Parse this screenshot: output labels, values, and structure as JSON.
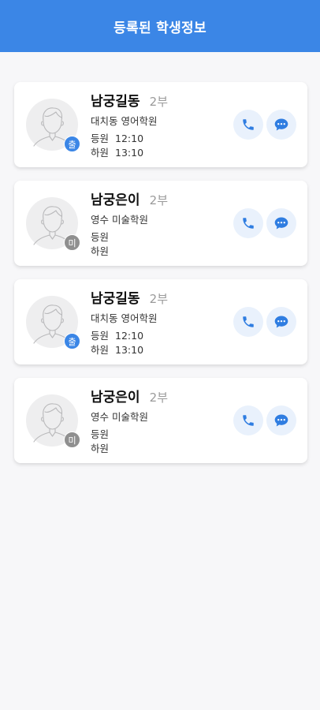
{
  "header": {
    "title": "등록된 학생정보"
  },
  "colors": {
    "accent": "#3b86e6",
    "button_bg": "#e9f1fc",
    "badge_absent": "#8f8f8f"
  },
  "students": [
    {
      "name": "남궁길동",
      "class": "2부",
      "academy": "대치동 영어학원",
      "badge": "출",
      "badge_state": "in",
      "checkin_label": "등원",
      "checkin_time": "12:10",
      "checkout_label": "하원",
      "checkout_time": "13:10",
      "call_icon": "phone-icon",
      "message_icon": "chat-icon"
    },
    {
      "name": "남궁은이",
      "class": "2부",
      "academy": "영수 미술학원",
      "badge": "미",
      "badge_state": "out",
      "checkin_label": "등원",
      "checkin_time": "",
      "checkout_label": "하원",
      "checkout_time": "",
      "call_icon": "phone-icon",
      "message_icon": "chat-icon"
    },
    {
      "name": "남궁길동",
      "class": "2부",
      "academy": "대치동 영어학원",
      "badge": "출",
      "badge_state": "in",
      "checkin_label": "등원",
      "checkin_time": "12:10",
      "checkout_label": "하원",
      "checkout_time": "13:10",
      "call_icon": "phone-icon",
      "message_icon": "chat-icon"
    },
    {
      "name": "남궁은이",
      "class": "2부",
      "academy": "영수 미술학원",
      "badge": "미",
      "badge_state": "out",
      "checkin_label": "등원",
      "checkin_time": "",
      "checkout_label": "하원",
      "checkout_time": "",
      "call_icon": "phone-icon",
      "message_icon": "chat-icon"
    }
  ]
}
